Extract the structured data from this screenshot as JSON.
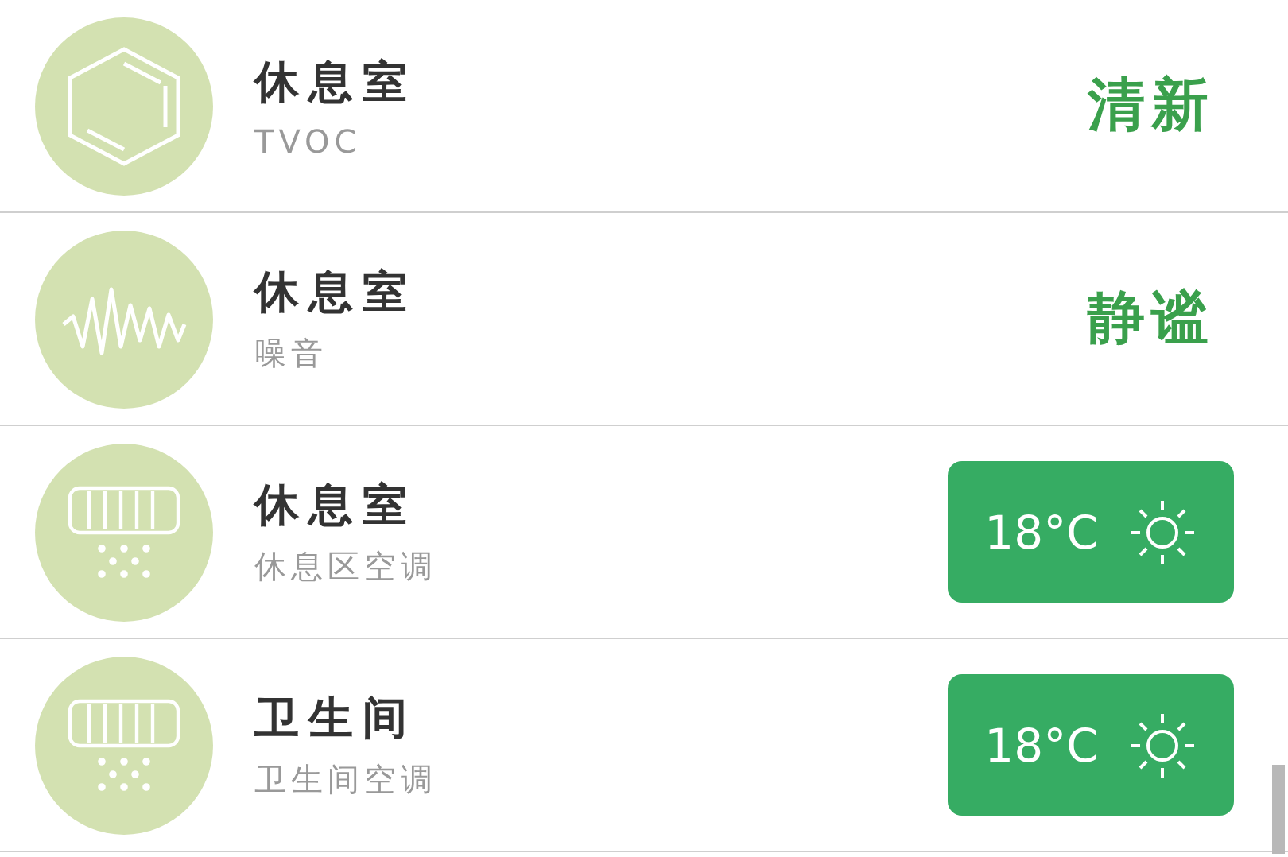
{
  "rows": [
    {
      "kind": "tvoc",
      "title": "休息室",
      "subtitle": "TVOC",
      "status": "清新"
    },
    {
      "kind": "noise",
      "title": "休息室",
      "subtitle": "噪音",
      "status": "静谧"
    },
    {
      "kind": "ac",
      "title": "休息室",
      "subtitle": "休息区空调",
      "temperature": "18°C"
    },
    {
      "kind": "ac",
      "title": "卫生间",
      "subtitle": "卫生间空调",
      "temperature": "18°C"
    }
  ]
}
